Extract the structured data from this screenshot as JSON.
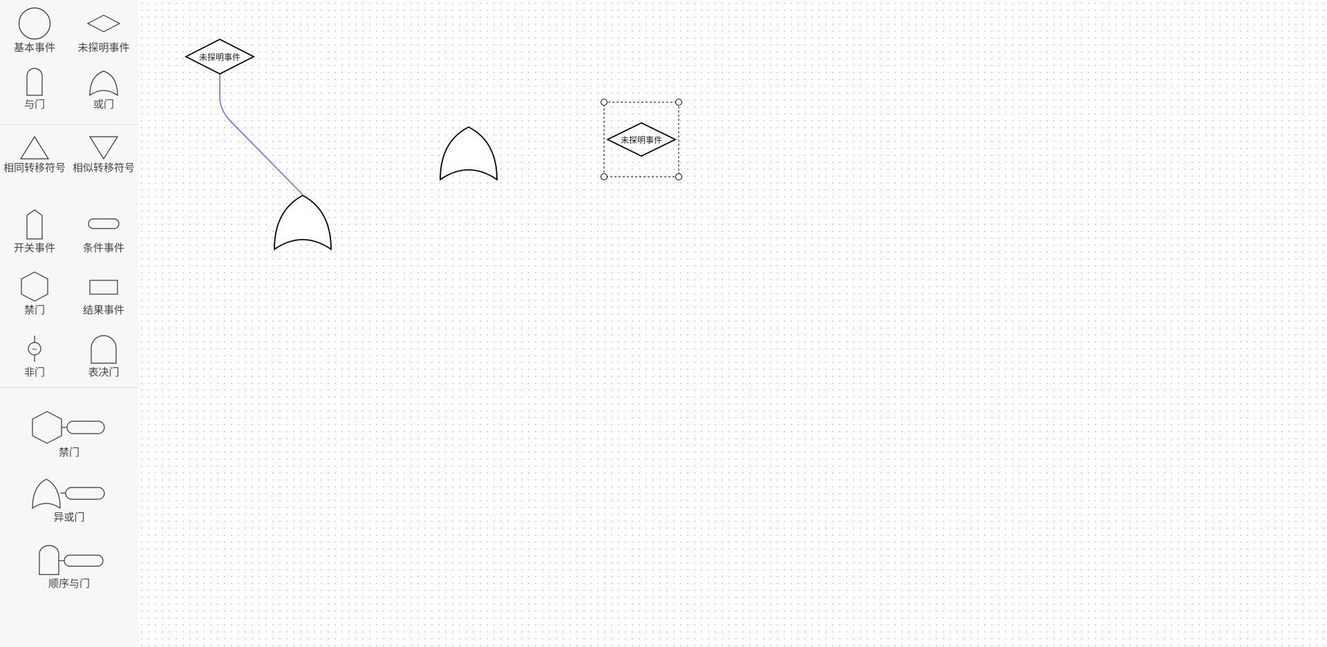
{
  "palette": {
    "basic": [
      {
        "label": "基本事件",
        "icon": "circle-icon"
      },
      {
        "label": "未探明事件",
        "icon": "diamond-icon"
      },
      {
        "label": "与门",
        "icon": "and-gate-icon"
      },
      {
        "label": "或门",
        "icon": "or-gate-icon"
      }
    ],
    "extended": [
      {
        "label": "相同转移符号",
        "icon": "triangle-up-icon"
      },
      {
        "label": "相似转移符号",
        "icon": "triangle-down-icon"
      },
      {
        "label": "开关事件",
        "icon": "house-icon"
      },
      {
        "label": "条件事件",
        "icon": "rounded-rect-icon"
      },
      {
        "label": "禁门",
        "icon": "hexagon-icon"
      },
      {
        "label": "结果事件",
        "icon": "rectangle-icon"
      },
      {
        "label": "非门",
        "icon": "not-gate-icon"
      },
      {
        "label": "表决门",
        "icon": "voting-gate-icon"
      }
    ],
    "combined": [
      {
        "label": "禁门",
        "icon": "inhibit-gate-with-condition-icon"
      },
      {
        "label": "异或门",
        "icon": "xor-gate-with-condition-icon"
      },
      {
        "label": "顺序与门",
        "icon": "priority-and-gate-with-condition-icon"
      }
    ]
  },
  "canvas": {
    "nodes": [
      {
        "type": "未探明事件",
        "label": "未探明事件"
      },
      {
        "type": "或门",
        "label": ""
      },
      {
        "type": "或门",
        "label": ""
      },
      {
        "type": "未探明事件",
        "label": "未探明事件",
        "selected": true
      }
    ],
    "edges": [
      {
        "from": 0,
        "to": 1,
        "color": "#7b68ee"
      }
    ]
  },
  "colors": {
    "edge": "#7b68ee",
    "stroke": "#000000",
    "grid_dot": "#c9c9c9"
  }
}
